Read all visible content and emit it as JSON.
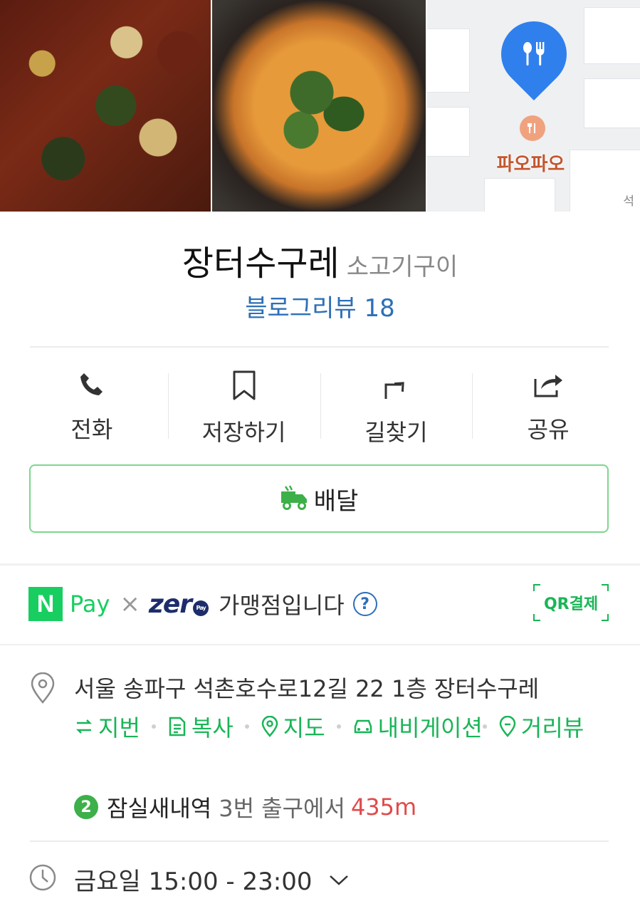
{
  "photos": {
    "map": {
      "pin_label": "파오파오",
      "corner_label": "석"
    }
  },
  "place": {
    "name": "장터수구레",
    "category": "소고기구이",
    "review_link": "블로그리뷰 18"
  },
  "actions": [
    {
      "label": "전화",
      "icon": "phone-icon"
    },
    {
      "label": "저장하기",
      "icon": "bookmark-icon"
    },
    {
      "label": "길찾기",
      "icon": "directions-icon"
    },
    {
      "label": "공유",
      "icon": "share-icon"
    }
  ],
  "delivery": {
    "label": "배달",
    "icon": "delivery-truck-icon"
  },
  "pay": {
    "npay_letter": "N",
    "npay_word": "Pay",
    "times": "×",
    "zero_word": "zer",
    "zero_badge": "Pay",
    "text": "가맹점입니다",
    "help_symbol": "?",
    "qr_label": "QR결제"
  },
  "address": {
    "text": "서울 송파구 석촌호수로12길 22 1층 장터수구레",
    "links": [
      {
        "label": "지번",
        "icon": "swap-icon"
      },
      {
        "label": "복사",
        "icon": "copy-icon"
      },
      {
        "label": "지도",
        "icon": "map-pin-icon"
      },
      {
        "label": "내비게이션",
        "icon": "car-icon"
      },
      {
        "label": "거리뷰",
        "icon": "street-view-icon"
      }
    ],
    "subway": {
      "line": "2",
      "station": "잠실새내역",
      "exit": "3번 출구에서",
      "distance": "435m"
    }
  },
  "hours": {
    "text": "금요일 15:00 - 23:00"
  },
  "colors": {
    "green": "#19ce60",
    "link_blue": "#2d6fb7",
    "distance_red": "#e04a4a",
    "line2_green": "#3db049"
  }
}
